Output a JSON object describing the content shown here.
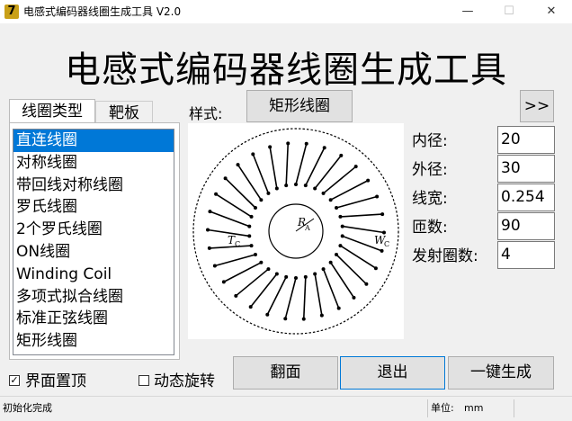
{
  "window": {
    "title": "电感式编码器线圈生成工具 V2.0",
    "minimize_glyph": "—",
    "maximize_glyph": "☐",
    "close_glyph": "✕",
    "icon_glyph": "7"
  },
  "header": {
    "title": "电感式编码器线圈生成工具"
  },
  "tabs": [
    {
      "label": "线圈类型"
    },
    {
      "label": "靶板"
    }
  ],
  "coil_types": [
    {
      "label": "直连线圈",
      "selected": true
    },
    {
      "label": "对称线圈"
    },
    {
      "label": "带回线对称线圈"
    },
    {
      "label": "罗氏线圈"
    },
    {
      "label": "2个罗氏线圈"
    },
    {
      "label": "ON线圈"
    },
    {
      "label": "Winding Coil"
    },
    {
      "label": "多项式拟合线圈"
    },
    {
      "label": "标准正弦线圈"
    },
    {
      "label": "矩形线圈"
    }
  ],
  "style": {
    "label": "样式:",
    "value": "矩形线圈",
    "more_label": ">>"
  },
  "preview": {
    "turns": 90,
    "label_r": "R",
    "label_r_sub": "A",
    "label_tc": "T",
    "label_tc_sub": "C",
    "label_wc": "W",
    "label_wc_sub": "C"
  },
  "params": [
    {
      "label": "内径:",
      "value": "20"
    },
    {
      "label": "外径:",
      "value": "30"
    },
    {
      "label": "线宽:",
      "value": "0.254"
    },
    {
      "label": "匝数:",
      "value": "90"
    },
    {
      "label": "发射圈数:",
      "value": "4"
    }
  ],
  "options": {
    "pin_top_label": "界面置顶",
    "pin_top_checked": true,
    "dynamic_rotate_label": "动态旋转",
    "dynamic_rotate_checked": false
  },
  "actions": {
    "flip_label": "翻面",
    "exit_label": "退出",
    "generate_label": "一键生成"
  },
  "status": {
    "message": "初始化完成",
    "unit_label": "单位:",
    "unit_value": "mm"
  }
}
